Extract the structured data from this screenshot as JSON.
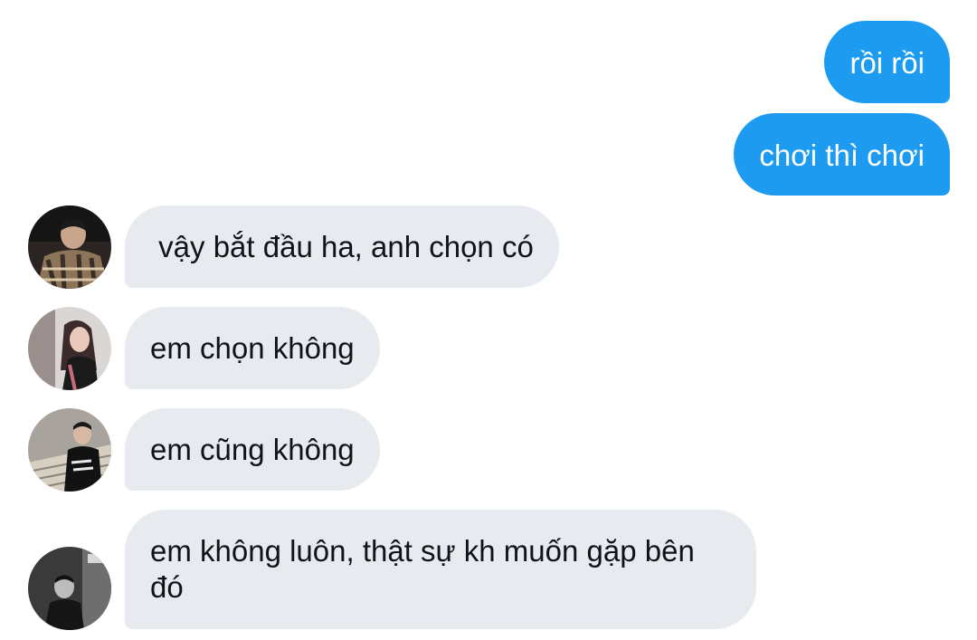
{
  "messages": {
    "outgoing": [
      {
        "text": "rồi rồi"
      },
      {
        "text": "chơi thì chơi"
      }
    ],
    "incoming": [
      {
        "text": " vậy bắt đầu ha, anh chọn có",
        "avatar": "avatar-photo-man-plaid-jacket"
      },
      {
        "text": "em chọn không",
        "avatar": "avatar-photo-woman-long-hair"
      },
      {
        "text": "em cũng không",
        "avatar": "avatar-photo-man-on-stairs"
      },
      {
        "text": "em không luôn, thật sự kh muốn gặp bên đó",
        "avatar": "avatar-photo-man-street-bw"
      }
    ]
  },
  "colors": {
    "outgoing_bubble": "#1d9bf0",
    "incoming_bubble": "#e7ebef",
    "incoming_text": "#0f1419",
    "background": "#ffffff"
  }
}
